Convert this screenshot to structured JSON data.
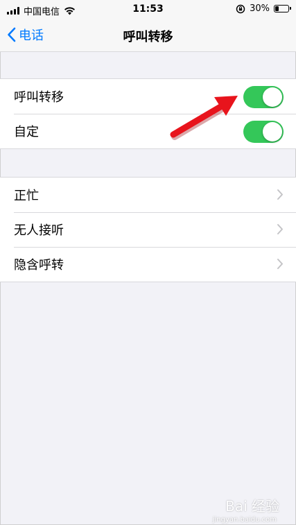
{
  "status": {
    "carrier": "中国电信",
    "time": "11:53",
    "battery": "30%",
    "battery_level": 0.3
  },
  "nav": {
    "back_label": "电话",
    "title": "呼叫转移"
  },
  "group1": {
    "items": [
      {
        "label": "呼叫转移",
        "toggle_on": true
      },
      {
        "label": "自定",
        "toggle_on": true
      }
    ]
  },
  "group2": {
    "items": [
      {
        "label": "正忙"
      },
      {
        "label": "无人接听"
      },
      {
        "label": "隐含呼转"
      }
    ]
  },
  "colors": {
    "toggle_on": "#34c759",
    "accent": "#007aff",
    "annotation_arrow": "#e8141c"
  },
  "icons": [
    "signal-icon",
    "wifi-icon",
    "orientation-lock-icon",
    "battery-icon",
    "chevron-left-icon",
    "chevron-right-icon"
  ],
  "watermark": {
    "brand": "Bai 经验",
    "sub": "jingyan.baidu.com"
  }
}
